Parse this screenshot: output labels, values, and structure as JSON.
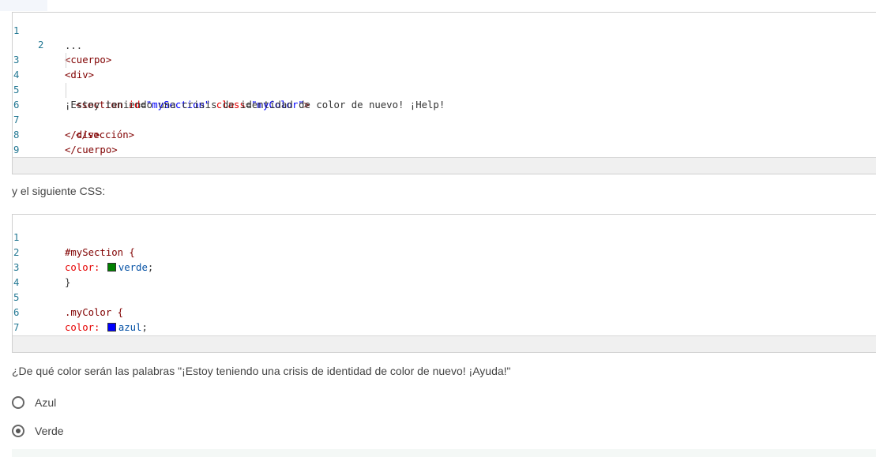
{
  "html_code": {
    "lines": [
      {
        "num": "1",
        "text": "..."
      },
      {
        "num": "2",
        "text": "<cuerpo>"
      },
      {
        "num": "3",
        "text": "<div>"
      },
      {
        "num": "4",
        "text": "<section id=\"mySection\" class=\"myColor\">"
      },
      {
        "num": "5",
        "text": "¡Estoy teniendo una crisis de identidad de color de nuevo! ¡Help!"
      },
      {
        "num": "6",
        "text": "</sección>"
      },
      {
        "num": "7",
        "text": "</div>"
      },
      {
        "num": "8",
        "text": "</cuerpo>"
      },
      {
        "num": "9",
        "text": "..."
      }
    ]
  },
  "intro_css": "y el siguiente CSS:",
  "css_code": {
    "lines": [
      {
        "num": "1",
        "text": "#mySection {"
      },
      {
        "num": "2",
        "text": "color: verde;"
      },
      {
        "num": "3",
        "text": "}"
      },
      {
        "num": "4",
        "text": ""
      },
      {
        "num": "5",
        "text": ".myColor {"
      },
      {
        "num": "6",
        "text": "color: azul;"
      },
      {
        "num": "7",
        "text": "}"
      }
    ],
    "swatches": {
      "verde": "#008000",
      "azul": "#0000ff"
    }
  },
  "question": "¿De qué color serán las palabras \"¡Estoy teniendo una crisis de identidad de color de nuevo! ¡Ayuda!\"",
  "options": [
    {
      "label": "Azul",
      "checked": false
    },
    {
      "label": "Verde",
      "checked": true
    }
  ]
}
